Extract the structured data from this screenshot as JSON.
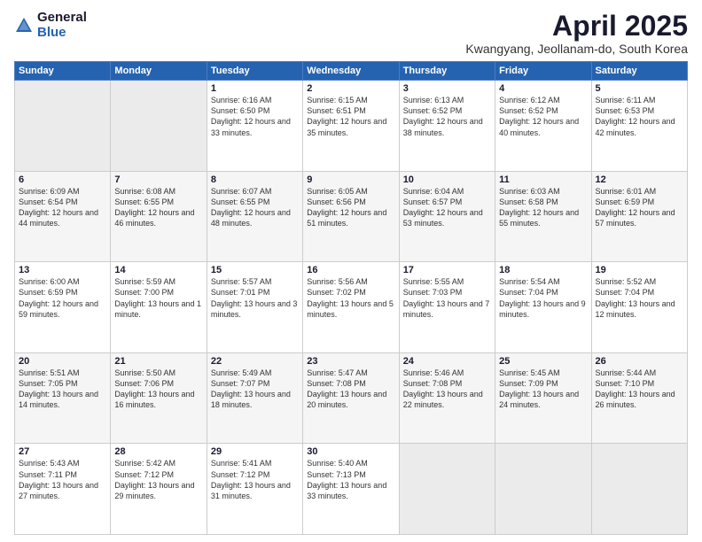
{
  "logo": {
    "general": "General",
    "blue": "Blue"
  },
  "title": "April 2025",
  "subtitle": "Kwangyang, Jeollanam-do, South Korea",
  "days": [
    "Sunday",
    "Monday",
    "Tuesday",
    "Wednesday",
    "Thursday",
    "Friday",
    "Saturday"
  ],
  "weeks": [
    [
      {
        "num": "",
        "sunrise": "",
        "sunset": "",
        "daylight": "",
        "empty": true
      },
      {
        "num": "",
        "sunrise": "",
        "sunset": "",
        "daylight": "",
        "empty": true
      },
      {
        "num": "1",
        "sunrise": "Sunrise: 6:16 AM",
        "sunset": "Sunset: 6:50 PM",
        "daylight": "Daylight: 12 hours and 33 minutes.",
        "empty": false
      },
      {
        "num": "2",
        "sunrise": "Sunrise: 6:15 AM",
        "sunset": "Sunset: 6:51 PM",
        "daylight": "Daylight: 12 hours and 35 minutes.",
        "empty": false
      },
      {
        "num": "3",
        "sunrise": "Sunrise: 6:13 AM",
        "sunset": "Sunset: 6:52 PM",
        "daylight": "Daylight: 12 hours and 38 minutes.",
        "empty": false
      },
      {
        "num": "4",
        "sunrise": "Sunrise: 6:12 AM",
        "sunset": "Sunset: 6:52 PM",
        "daylight": "Daylight: 12 hours and 40 minutes.",
        "empty": false
      },
      {
        "num": "5",
        "sunrise": "Sunrise: 6:11 AM",
        "sunset": "Sunset: 6:53 PM",
        "daylight": "Daylight: 12 hours and 42 minutes.",
        "empty": false
      }
    ],
    [
      {
        "num": "6",
        "sunrise": "Sunrise: 6:09 AM",
        "sunset": "Sunset: 6:54 PM",
        "daylight": "Daylight: 12 hours and 44 minutes.",
        "empty": false
      },
      {
        "num": "7",
        "sunrise": "Sunrise: 6:08 AM",
        "sunset": "Sunset: 6:55 PM",
        "daylight": "Daylight: 12 hours and 46 minutes.",
        "empty": false
      },
      {
        "num": "8",
        "sunrise": "Sunrise: 6:07 AM",
        "sunset": "Sunset: 6:55 PM",
        "daylight": "Daylight: 12 hours and 48 minutes.",
        "empty": false
      },
      {
        "num": "9",
        "sunrise": "Sunrise: 6:05 AM",
        "sunset": "Sunset: 6:56 PM",
        "daylight": "Daylight: 12 hours and 51 minutes.",
        "empty": false
      },
      {
        "num": "10",
        "sunrise": "Sunrise: 6:04 AM",
        "sunset": "Sunset: 6:57 PM",
        "daylight": "Daylight: 12 hours and 53 minutes.",
        "empty": false
      },
      {
        "num": "11",
        "sunrise": "Sunrise: 6:03 AM",
        "sunset": "Sunset: 6:58 PM",
        "daylight": "Daylight: 12 hours and 55 minutes.",
        "empty": false
      },
      {
        "num": "12",
        "sunrise": "Sunrise: 6:01 AM",
        "sunset": "Sunset: 6:59 PM",
        "daylight": "Daylight: 12 hours and 57 minutes.",
        "empty": false
      }
    ],
    [
      {
        "num": "13",
        "sunrise": "Sunrise: 6:00 AM",
        "sunset": "Sunset: 6:59 PM",
        "daylight": "Daylight: 12 hours and 59 minutes.",
        "empty": false
      },
      {
        "num": "14",
        "sunrise": "Sunrise: 5:59 AM",
        "sunset": "Sunset: 7:00 PM",
        "daylight": "Daylight: 13 hours and 1 minute.",
        "empty": false
      },
      {
        "num": "15",
        "sunrise": "Sunrise: 5:57 AM",
        "sunset": "Sunset: 7:01 PM",
        "daylight": "Daylight: 13 hours and 3 minutes.",
        "empty": false
      },
      {
        "num": "16",
        "sunrise": "Sunrise: 5:56 AM",
        "sunset": "Sunset: 7:02 PM",
        "daylight": "Daylight: 13 hours and 5 minutes.",
        "empty": false
      },
      {
        "num": "17",
        "sunrise": "Sunrise: 5:55 AM",
        "sunset": "Sunset: 7:03 PM",
        "daylight": "Daylight: 13 hours and 7 minutes.",
        "empty": false
      },
      {
        "num": "18",
        "sunrise": "Sunrise: 5:54 AM",
        "sunset": "Sunset: 7:04 PM",
        "daylight": "Daylight: 13 hours and 9 minutes.",
        "empty": false
      },
      {
        "num": "19",
        "sunrise": "Sunrise: 5:52 AM",
        "sunset": "Sunset: 7:04 PM",
        "daylight": "Daylight: 13 hours and 12 minutes.",
        "empty": false
      }
    ],
    [
      {
        "num": "20",
        "sunrise": "Sunrise: 5:51 AM",
        "sunset": "Sunset: 7:05 PM",
        "daylight": "Daylight: 13 hours and 14 minutes.",
        "empty": false
      },
      {
        "num": "21",
        "sunrise": "Sunrise: 5:50 AM",
        "sunset": "Sunset: 7:06 PM",
        "daylight": "Daylight: 13 hours and 16 minutes.",
        "empty": false
      },
      {
        "num": "22",
        "sunrise": "Sunrise: 5:49 AM",
        "sunset": "Sunset: 7:07 PM",
        "daylight": "Daylight: 13 hours and 18 minutes.",
        "empty": false
      },
      {
        "num": "23",
        "sunrise": "Sunrise: 5:47 AM",
        "sunset": "Sunset: 7:08 PM",
        "daylight": "Daylight: 13 hours and 20 minutes.",
        "empty": false
      },
      {
        "num": "24",
        "sunrise": "Sunrise: 5:46 AM",
        "sunset": "Sunset: 7:08 PM",
        "daylight": "Daylight: 13 hours and 22 minutes.",
        "empty": false
      },
      {
        "num": "25",
        "sunrise": "Sunrise: 5:45 AM",
        "sunset": "Sunset: 7:09 PM",
        "daylight": "Daylight: 13 hours and 24 minutes.",
        "empty": false
      },
      {
        "num": "26",
        "sunrise": "Sunrise: 5:44 AM",
        "sunset": "Sunset: 7:10 PM",
        "daylight": "Daylight: 13 hours and 26 minutes.",
        "empty": false
      }
    ],
    [
      {
        "num": "27",
        "sunrise": "Sunrise: 5:43 AM",
        "sunset": "Sunset: 7:11 PM",
        "daylight": "Daylight: 13 hours and 27 minutes.",
        "empty": false
      },
      {
        "num": "28",
        "sunrise": "Sunrise: 5:42 AM",
        "sunset": "Sunset: 7:12 PM",
        "daylight": "Daylight: 13 hours and 29 minutes.",
        "empty": false
      },
      {
        "num": "29",
        "sunrise": "Sunrise: 5:41 AM",
        "sunset": "Sunset: 7:12 PM",
        "daylight": "Daylight: 13 hours and 31 minutes.",
        "empty": false
      },
      {
        "num": "30",
        "sunrise": "Sunrise: 5:40 AM",
        "sunset": "Sunset: 7:13 PM",
        "daylight": "Daylight: 13 hours and 33 minutes.",
        "empty": false
      },
      {
        "num": "",
        "sunrise": "",
        "sunset": "",
        "daylight": "",
        "empty": true
      },
      {
        "num": "",
        "sunrise": "",
        "sunset": "",
        "daylight": "",
        "empty": true
      },
      {
        "num": "",
        "sunrise": "",
        "sunset": "",
        "daylight": "",
        "empty": true
      }
    ]
  ]
}
